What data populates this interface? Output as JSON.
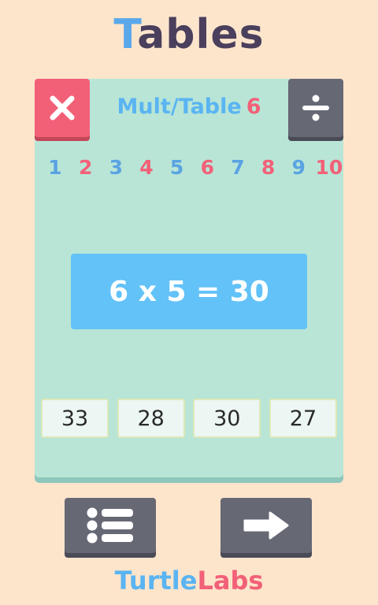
{
  "app": {
    "title_first": "T",
    "title_rest": "ables",
    "brand_first": "Turtle",
    "brand_second": "Labs"
  },
  "header": {
    "label": "Mult/Table",
    "table_number": "6",
    "mult_icon": "multiply-icon",
    "div_icon": "divide-icon"
  },
  "numbers": [
    "1",
    "2",
    "3",
    "4",
    "5",
    "6",
    "7",
    "8",
    "9",
    "10"
  ],
  "question": {
    "equation": "6 x 5 = 30"
  },
  "answers": [
    "33",
    "28",
    "30",
    "27"
  ],
  "nav": {
    "list_icon": "list-icon",
    "next_icon": "arrow-right-icon"
  },
  "colors": {
    "background": "#fde5cc",
    "card": "#b8e5d6",
    "blue": "#5ab4f2",
    "red": "#f26078",
    "dark": "#666874",
    "equation_bg": "#63c2f7"
  }
}
